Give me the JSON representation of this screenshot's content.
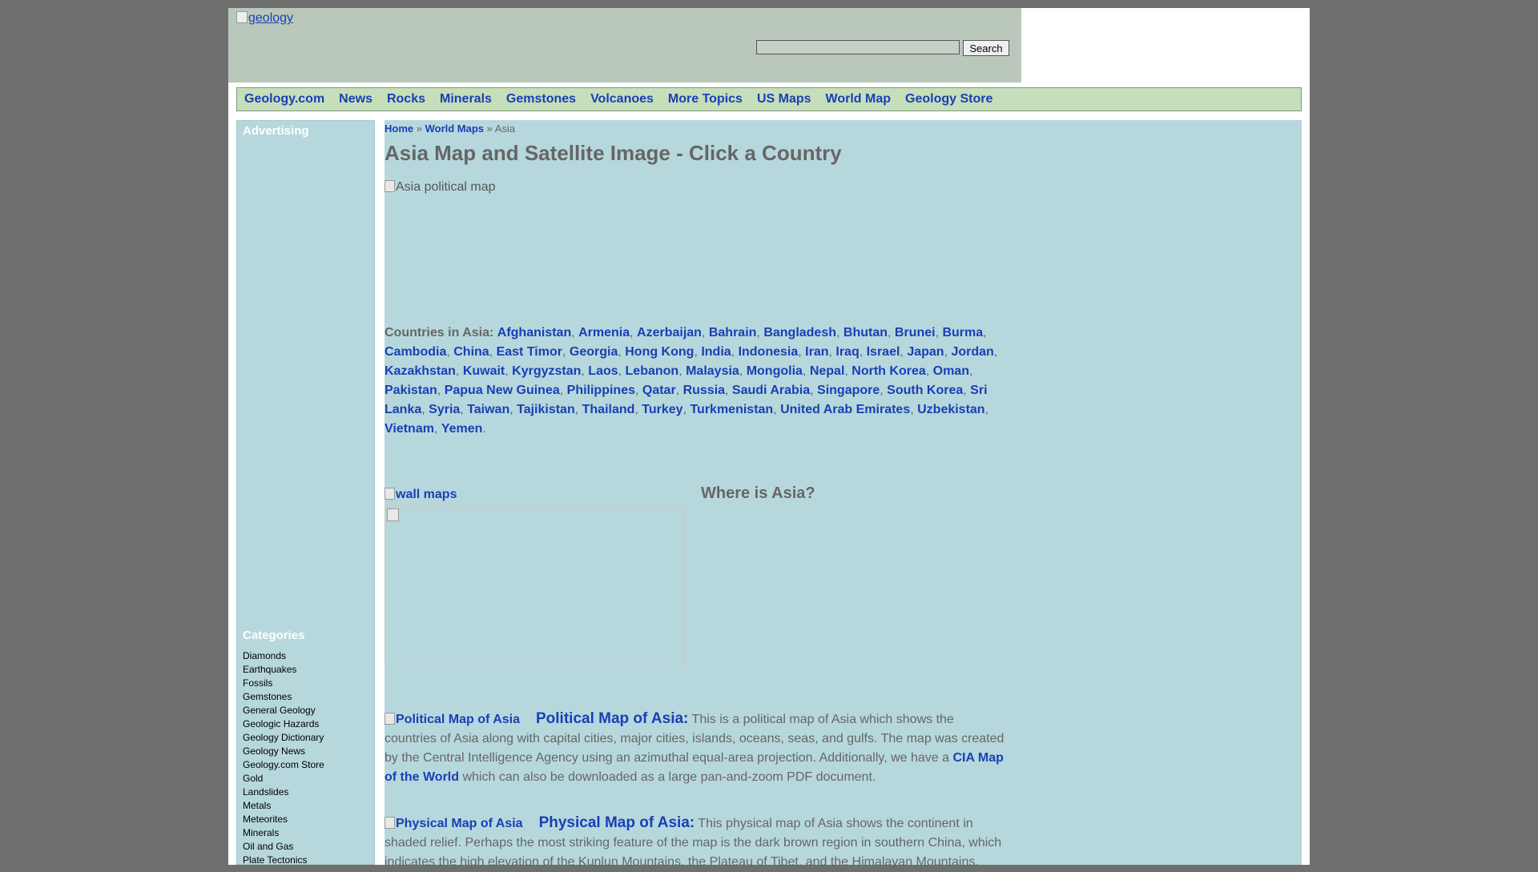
{
  "header": {
    "logo_alt": "geology",
    "search_button": "Search",
    "search_value": ""
  },
  "nav": {
    "items": [
      "Geology.com",
      "News",
      "Rocks",
      "Minerals",
      "Gemstones",
      "Volcanoes",
      "More Topics",
      "US Maps",
      "World Map",
      "Geology Store"
    ]
  },
  "sidebar": {
    "advertising_heading": "Advertising",
    "categories_heading": "Categories",
    "categories": [
      "Diamonds",
      "Earthquakes",
      "Fossils",
      "Gemstones",
      "General Geology",
      "Geologic Hazards",
      "Geology Dictionary",
      "Geology News",
      "Geology.com Store",
      "Gold",
      "Landslides",
      "Metals",
      "Meteorites",
      "Minerals",
      "Oil and Gas",
      "Plate Tectonics"
    ]
  },
  "breadcrumb": {
    "home": "Home",
    "sep1": " » ",
    "world_maps": "World Maps",
    "sep2": " » ",
    "current": "Asia"
  },
  "main": {
    "title": "Asia Map and Satellite Image - Click a Country",
    "map_alt": "Asia political map",
    "countries_lead": "Countries in Asia:",
    "countries": [
      "Afghanistan",
      "Armenia",
      "Azerbaijan",
      "Bahrain",
      "Bangladesh",
      "Bhutan",
      "Brunei",
      "Burma",
      "Cambodia",
      "China",
      "East Timor",
      "Georgia",
      "Hong Kong",
      "India",
      "Indonesia",
      "Iran",
      "Iraq",
      "Israel",
      "Japan",
      "Jordan",
      "Kazakhstan",
      "Kuwait",
      "Kyrgyzstan",
      "Laos",
      "Lebanon",
      "Malaysia",
      "Mongolia",
      "Nepal",
      "North Korea",
      "Oman",
      "Pakistan",
      "Papua New Guinea",
      "Philippines",
      "Qatar",
      "Russia",
      "Saudi Arabia",
      "Singapore",
      "South Korea",
      "Sri Lanka",
      "Syria",
      "Taiwan",
      "Tajikistan",
      "Thailand",
      "Turkey",
      "Turkmenistan",
      "United Arab Emirates",
      "Uzbekistan",
      "Vietnam",
      "Yemen"
    ],
    "wall_maps_alt": "wall maps",
    "where_heading": "Where is Asia?",
    "political": {
      "img_alt": "Political Map of Asia",
      "title": "Political Map of Asia:",
      "text1": " This is a political map of Asia which shows the countries of Asia along with capital cities, major cities, islands, oceans, seas, and gulfs. The map was created by the Central Intelligence Agency using an azimuthal equal-area projection. Additionally, we have a ",
      "link": "CIA Map of the World",
      "text2": " which can also be downloaded as a large pan-and-zoom PDF document."
    },
    "physical": {
      "img_alt": "Physical Map of Asia",
      "title": "Physical Map of Asia:",
      "text1": " This physical map of Asia shows the continent in shaded relief. Perhaps the most striking feature of the map is the dark brown region in southern China, which indicates the high elevation of the Kunlun Mountains, the Plateau of Tibet, and the Himalayan Mountains."
    }
  }
}
